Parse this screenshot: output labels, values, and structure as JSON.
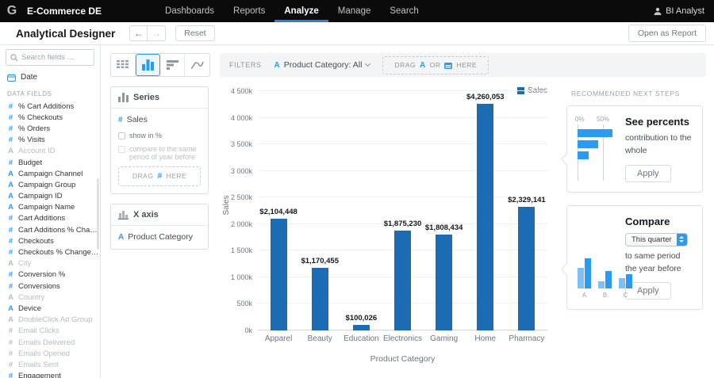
{
  "topbar": {
    "brand": "E-Commerce DE",
    "nav": [
      {
        "label": "Dashboards",
        "active": false
      },
      {
        "label": "Reports",
        "active": false
      },
      {
        "label": "Analyze",
        "active": true
      },
      {
        "label": "Manage",
        "active": false
      },
      {
        "label": "Search",
        "active": false
      }
    ],
    "user_label": "BI Analyst"
  },
  "subheader": {
    "title": "Analytical Designer",
    "reset_label": "Reset",
    "open_report_label": "Open as Report"
  },
  "sidebar": {
    "search_placeholder": "Search fields ...",
    "date_label": "Date",
    "section_label": "DATA FIELDS",
    "fields": [
      {
        "label": "% Cart Additions",
        "type": "measure",
        "enabled": true
      },
      {
        "label": "% Checkouts",
        "type": "measure",
        "enabled": true
      },
      {
        "label": "% Orders",
        "type": "measure",
        "enabled": true
      },
      {
        "label": "% Visits",
        "type": "measure",
        "enabled": true
      },
      {
        "label": "Account ID",
        "type": "attribute",
        "enabled": false
      },
      {
        "label": "Budget",
        "type": "measure",
        "enabled": true
      },
      {
        "label": "Campaign Channel",
        "type": "attribute",
        "enabled": true
      },
      {
        "label": "Campaign Group",
        "type": "attribute",
        "enabled": true
      },
      {
        "label": "Campaign ID",
        "type": "attribute",
        "enabled": true
      },
      {
        "label": "Campaign Name",
        "type": "attribute",
        "enabled": true
      },
      {
        "label": "Cart Additions",
        "type": "measure",
        "enabled": true
      },
      {
        "label": "Cart Additions % Change YoY",
        "type": "measure",
        "enabled": true
      },
      {
        "label": "Checkouts",
        "type": "measure",
        "enabled": true
      },
      {
        "label": "Checkouts % Change YoY",
        "type": "measure",
        "enabled": true
      },
      {
        "label": "City",
        "type": "attribute",
        "enabled": false
      },
      {
        "label": "Conversion %",
        "type": "measure",
        "enabled": true
      },
      {
        "label": "Conversions",
        "type": "measure",
        "enabled": true
      },
      {
        "label": "Country",
        "type": "attribute",
        "enabled": false
      },
      {
        "label": "Device",
        "type": "attribute",
        "enabled": true
      },
      {
        "label": "DoubleClick Ad Group",
        "type": "attribute",
        "enabled": false
      },
      {
        "label": "Email Clicks",
        "type": "measure",
        "enabled": false
      },
      {
        "label": "Emails Delivered",
        "type": "measure",
        "enabled": false
      },
      {
        "label": "Emails Opened",
        "type": "measure",
        "enabled": false
      },
      {
        "label": "Emails Sent",
        "type": "measure",
        "enabled": false
      },
      {
        "label": "Engagement",
        "type": "measure",
        "enabled": true
      }
    ]
  },
  "toolbar": {
    "filters_label": "FILTERS",
    "filter_value": "Product Category: All",
    "dropzone": {
      "drag": "DRAG",
      "attr": "A",
      "or": "OR",
      "here": "HERE"
    }
  },
  "series_panel": {
    "title": "Series",
    "metric_icon": "#",
    "metric": "Sales",
    "checkbox1": "show in %",
    "checkbox2": "compare to the same period of year before",
    "dropzone": {
      "drag": "DRAG",
      "icon": "#",
      "here": "HERE"
    }
  },
  "xaxis_panel": {
    "title": "X axis",
    "attr_icon": "A",
    "attribute": "Product Category"
  },
  "chart_data": {
    "type": "bar",
    "title": "",
    "series_name": "Sales",
    "categories": [
      "Apparel",
      "Beauty",
      "Education",
      "Electronics",
      "Gaming",
      "Home",
      "Pharmacy"
    ],
    "values": [
      2104448,
      1170455,
      100026,
      1875230,
      1808434,
      4260053,
      2329141
    ],
    "value_labels": [
      "$2,104,448",
      "$1,170,455",
      "$100,026",
      "$1,875,230",
      "$1,808,434",
      "$4,260,053",
      "$2,329,141"
    ],
    "xlabel": "Product Category",
    "ylabel": "Sales",
    "ylim": [
      0,
      4500000
    ],
    "ytick_step": 500000,
    "ytick_labels": [
      "0k",
      "500k",
      "1 000k",
      "1 500k",
      "2 000k",
      "2 500k",
      "3 000k",
      "3 500k",
      "4 000k",
      "4 500k"
    ],
    "bar_color": "#1c6cb4",
    "grid": true,
    "legend_position": "top-right"
  },
  "recommendations": {
    "header": "RECOMMENDED NEXT STEPS",
    "cards": [
      {
        "title": "See percents",
        "description": "contribution to the whole",
        "apply_label": "Apply",
        "mini_axis": [
          "0%",
          "50%"
        ],
        "mini_bars": [
          44,
          26,
          14
        ]
      },
      {
        "title": "Compare",
        "dropdown_value": "This quarter",
        "description": "to same period the year before",
        "apply_label": "Apply",
        "mini_groups": [
          {
            "label": "A",
            "bars": [
              26,
              38
            ]
          },
          {
            "label": "B",
            "bars": [
              9,
              22
            ]
          },
          {
            "label": "C",
            "bars": [
              13,
              18
            ]
          }
        ]
      }
    ]
  },
  "colors": {
    "accent": "#2b9af3",
    "bar": "#1c6cb4",
    "mini_light": "#7cc0f6",
    "mini_dark": "#2b9af3",
    "nav_underline": "#2e7cd6"
  }
}
